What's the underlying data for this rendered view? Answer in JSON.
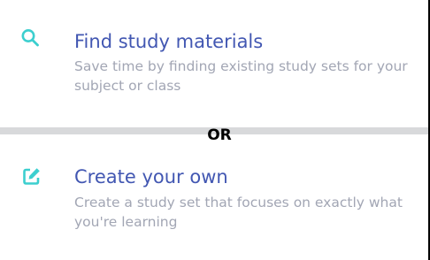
{
  "find_option": {
    "icon": "search-icon",
    "title": "Find study materials",
    "description": "Save time by finding existing study sets for your subject or class"
  },
  "separator": {
    "label": "OR"
  },
  "create_option": {
    "icon": "edit-icon",
    "title": "Create your own",
    "description": "Create a study set that focuses on exactly what you're learning"
  },
  "colors": {
    "title": "#4257b2",
    "description": "#a2a6b4",
    "icon": "#3ccfcf",
    "divider": "#d8d9db"
  }
}
